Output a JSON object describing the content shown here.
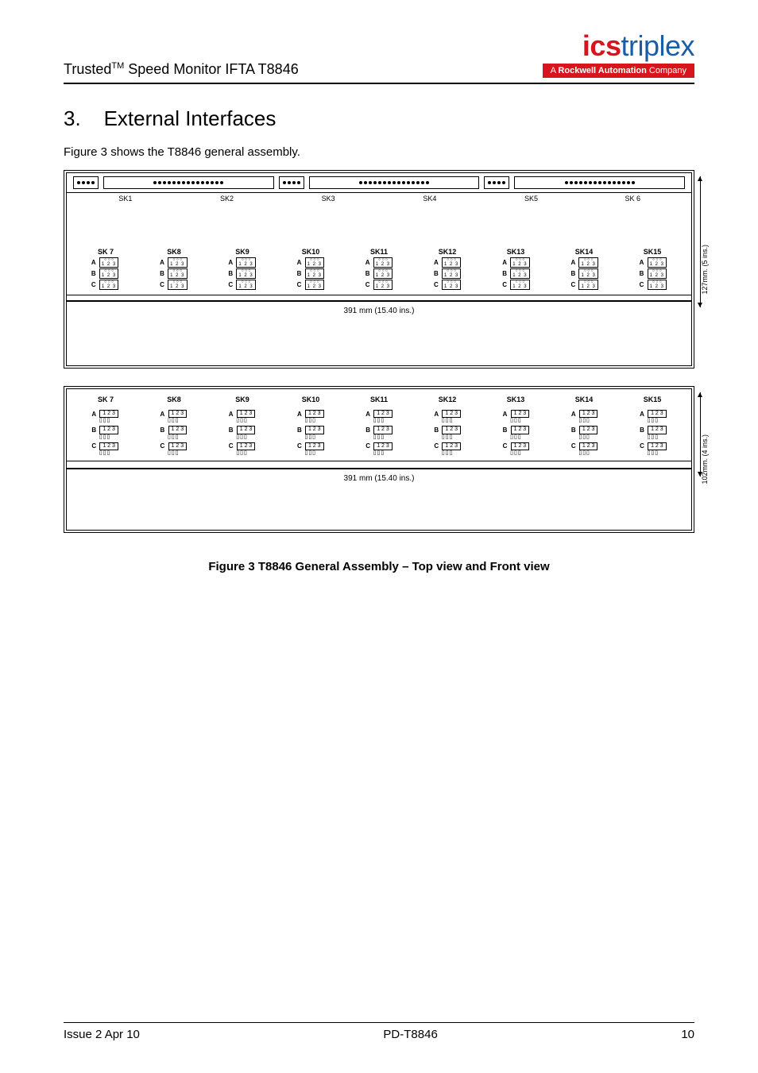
{
  "header": {
    "product_line": "Trusted",
    "tm": "TM",
    "product_name": "Speed Monitor IFTA T8846",
    "logo_part1": "ics",
    "logo_part2": "triplex",
    "logo_tagline_prefix": "A",
    "logo_tagline_bold": "Rockwell Automation",
    "logo_tagline_suffix": "Company"
  },
  "section": {
    "number": "3.",
    "title": "External Interfaces"
  },
  "intro": "Figure 3 shows the T8846 general assembly.",
  "diagram1": {
    "sk_top_labels": [
      "SK1",
      "SK2",
      "SK3",
      "SK4",
      "SK5",
      "SK 6"
    ],
    "col_headers": [
      "SK 7",
      "SK8",
      "SK9",
      "SK10",
      "SK11",
      "SK12",
      "SK13",
      "SK14",
      "SK15"
    ],
    "row_letters": [
      "A",
      "B",
      "C"
    ],
    "term_numbers": "1 2 3",
    "width_dim": "391 mm (15.40 ins.)",
    "height_dim": "127mm. (5 ins.)"
  },
  "diagram2": {
    "col_headers": [
      "SK 7",
      "SK8",
      "SK9",
      "SK10",
      "SK11",
      "SK12",
      "SK13",
      "SK14",
      "SK15"
    ],
    "row_letters": [
      "A",
      "B",
      "C"
    ],
    "term_numbers": "1 2 3",
    "width_dim": "391 mm (15.40 ins.)",
    "height_dim": "102mm. (4 ins.)"
  },
  "figure_caption": "Figure 3 T8846 General Assembly – Top view and Front view",
  "footer": {
    "left": "Issue 2 Apr 10",
    "center": "PD-T8846",
    "right": "10"
  }
}
